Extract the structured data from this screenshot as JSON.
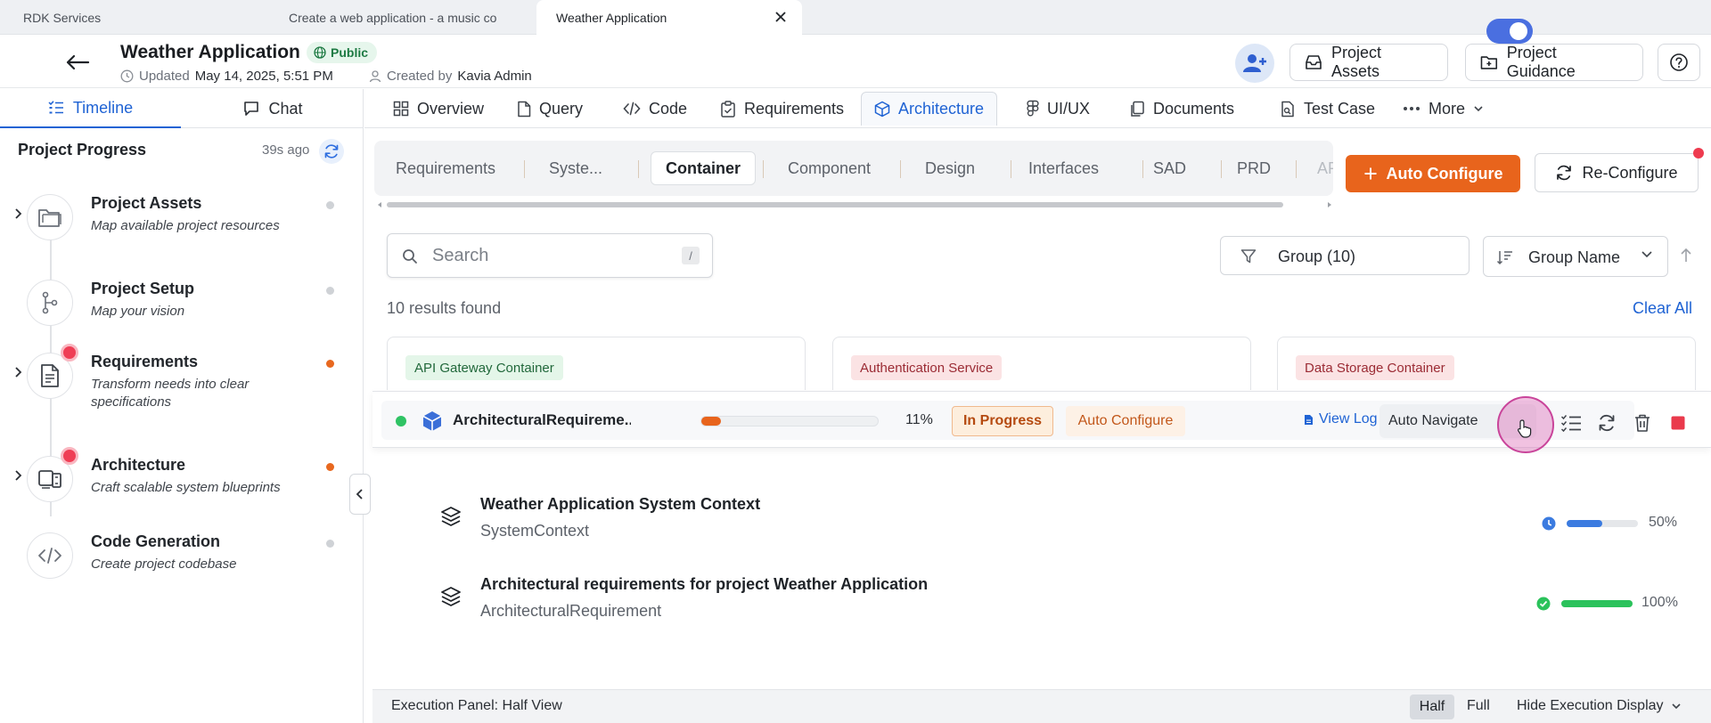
{
  "browser_tabs": [
    {
      "label": "RDK Services"
    },
    {
      "label": "Create a web application - a music co"
    },
    {
      "label": "Weather Application"
    }
  ],
  "header": {
    "title": "Weather Application",
    "visibility": "Public",
    "updated_label": "Updated",
    "updated_value": "May 14, 2025, 5:51 PM",
    "created_label": "Created by",
    "created_value": "Kavia Admin",
    "project_assets": "Project Assets",
    "project_guidance": "Project Guidance"
  },
  "left_panel": {
    "tabs": [
      {
        "label": "Timeline"
      },
      {
        "label": "Chat"
      }
    ],
    "progress_title": "Project Progress",
    "progress_time": "39s ago",
    "steps": [
      {
        "title": "Project Assets",
        "desc": "Map available project resources",
        "icon": "folder-icon"
      },
      {
        "title": "Project Setup",
        "desc": "Map your vision",
        "icon": "git-branch-icon"
      },
      {
        "title": "Requirements",
        "desc": "Transform needs into clear specifications",
        "icon": "document-icon"
      },
      {
        "title": "Architecture",
        "desc": "Craft scalable system blueprints",
        "icon": "devices-icon"
      },
      {
        "title": "Code Generation",
        "desc": "Create project codebase",
        "icon": "code-icon"
      }
    ]
  },
  "main_tabs": [
    {
      "label": "Overview"
    },
    {
      "label": "Query"
    },
    {
      "label": "Code"
    },
    {
      "label": "Requirements"
    },
    {
      "label": "Architecture"
    },
    {
      "label": "UI/UX"
    },
    {
      "label": "Documents"
    },
    {
      "label": "Test Case"
    },
    {
      "label": "More"
    }
  ],
  "sub_tabs": [
    {
      "label": "Requirements"
    },
    {
      "label": "Syste..."
    },
    {
      "label": "Container"
    },
    {
      "label": "Component"
    },
    {
      "label": "Design"
    },
    {
      "label": "Interfaces"
    },
    {
      "label": "SAD"
    },
    {
      "label": "PRD"
    },
    {
      "label": "AP"
    }
  ],
  "actions": {
    "auto_configure": "Auto Configure",
    "reconfigure": "Re-Configure"
  },
  "search": {
    "placeholder": "Search",
    "shortcut": "/"
  },
  "filters": {
    "group": "Group (10)",
    "sort": "Group Name"
  },
  "results": {
    "count_text": "10 results found",
    "clear_all": "Clear All"
  },
  "cards": [
    {
      "label": "API Gateway Container"
    },
    {
      "label": "Authentication Service"
    },
    {
      "label": "Data Storage Container"
    }
  ],
  "execution": {
    "name": "ArchitecturalRequireme...",
    "progress": 11,
    "progress_text": "11%",
    "status": "In Progress",
    "mode": "Auto Configure",
    "view_log": "View Log",
    "auto_navigate": "Auto Navigate"
  },
  "tasks": [
    {
      "title": "Weather Application System Context",
      "type": "SystemContext",
      "progress": 50,
      "progress_text": "50%",
      "color": "#3b7be0"
    },
    {
      "title": "Architectural requirements for project Weather Application",
      "type": "ArchitecturalRequirement",
      "progress": 100,
      "progress_text": "100%",
      "color": "#2bc25b"
    }
  ],
  "bottom_bar": {
    "label": "Execution Panel: Half View",
    "half": "Half",
    "full": "Full",
    "hide": "Hide Execution Display"
  }
}
